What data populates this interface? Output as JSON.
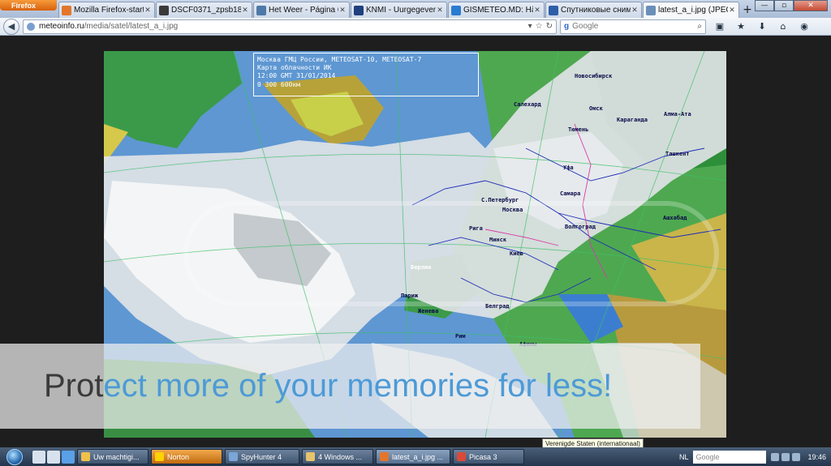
{
  "browser": {
    "menu_button": "Firefox",
    "tabs": [
      {
        "label": "Mozilla Firefox-start...",
        "favicon": "firefox-icon",
        "color": "#e3762b",
        "active": false
      },
      {
        "label": "DSCF0371_zpsb187c...",
        "favicon": "image-icon",
        "color": "#3a3a3a",
        "active": false
      },
      {
        "label": "Het Weer - Página 6...",
        "favicon": "globe-icon",
        "color": "#4e79a8",
        "active": false
      },
      {
        "label": "KNMI - Uurgegeven...",
        "favicon": "knmi-icon",
        "color": "#1f3f7f",
        "active": false
      },
      {
        "label": "GISMETEO.MD: Hărț...",
        "favicon": "gismeteo-icon",
        "color": "#2a7bd1",
        "active": false
      },
      {
        "label": "Спутниковые сним...",
        "favicon": "meteo-icon",
        "color": "#2d5fa8",
        "active": false
      },
      {
        "label": "latest_a_i.jpg (JPEG-...",
        "favicon": "image-icon",
        "color": "#6b8fb8",
        "active": true
      }
    ],
    "new_tab": "+",
    "url_host": "meteoinfo.ru",
    "url_path": "/media/satel/latest_a_i.jpg",
    "search_placeholder": "Google",
    "window_controls": {
      "minimize": "—",
      "maximize": "▫",
      "close": "✕"
    }
  },
  "map": {
    "header_line1": "Москва ГМЦ России, METEOSAT-10, METEOSAT-7",
    "header_line2": "Карта облачности ИК",
    "header_line3": "12:00 GMT 31/01/2014",
    "scale": "0   300  600км",
    "cities": [
      {
        "name": "Новосибирск"
      },
      {
        "name": "Салехард"
      },
      {
        "name": "Омск"
      },
      {
        "name": "Караганда"
      },
      {
        "name": "Алма-Ата"
      },
      {
        "name": "Тюмень"
      },
      {
        "name": "Ташкент"
      },
      {
        "name": "Уфа"
      },
      {
        "name": "Самара"
      },
      {
        "name": "С.Петербург"
      },
      {
        "name": "Москва"
      },
      {
        "name": "Рига"
      },
      {
        "name": "Минск"
      },
      {
        "name": "Волгоград"
      },
      {
        "name": "Ашхабад"
      },
      {
        "name": "Киев"
      },
      {
        "name": "Берлин"
      },
      {
        "name": "Париж"
      },
      {
        "name": "Женева"
      },
      {
        "name": "Белград"
      },
      {
        "name": "Рим"
      },
      {
        "name": "Афины"
      }
    ],
    "watermark": {
      "part1": "Prot",
      "part2": "ect more of your memories for less!"
    }
  },
  "taskbar": {
    "buttons": [
      {
        "label": "Uw machtigi...",
        "color": "#f0c24a",
        "style": "normal"
      },
      {
        "label": "Norton",
        "color": "#ffd200",
        "style": "orange"
      },
      {
        "label": "SpyHunter 4",
        "color": "#7aa6d8",
        "style": "normal"
      },
      {
        "label": "4 Windows ...",
        "color": "#e6c46c",
        "style": "normal"
      },
      {
        "label": "latest_a_i.jpg ...",
        "color": "#e3762b",
        "style": "active"
      },
      {
        "label": "Picasa 3",
        "color": "#d94a3a",
        "style": "normal"
      }
    ],
    "tooltip": "Verenigde Staten (internationaal)",
    "language": "NL",
    "search_placeholder": "Google",
    "clock": "19:46"
  }
}
